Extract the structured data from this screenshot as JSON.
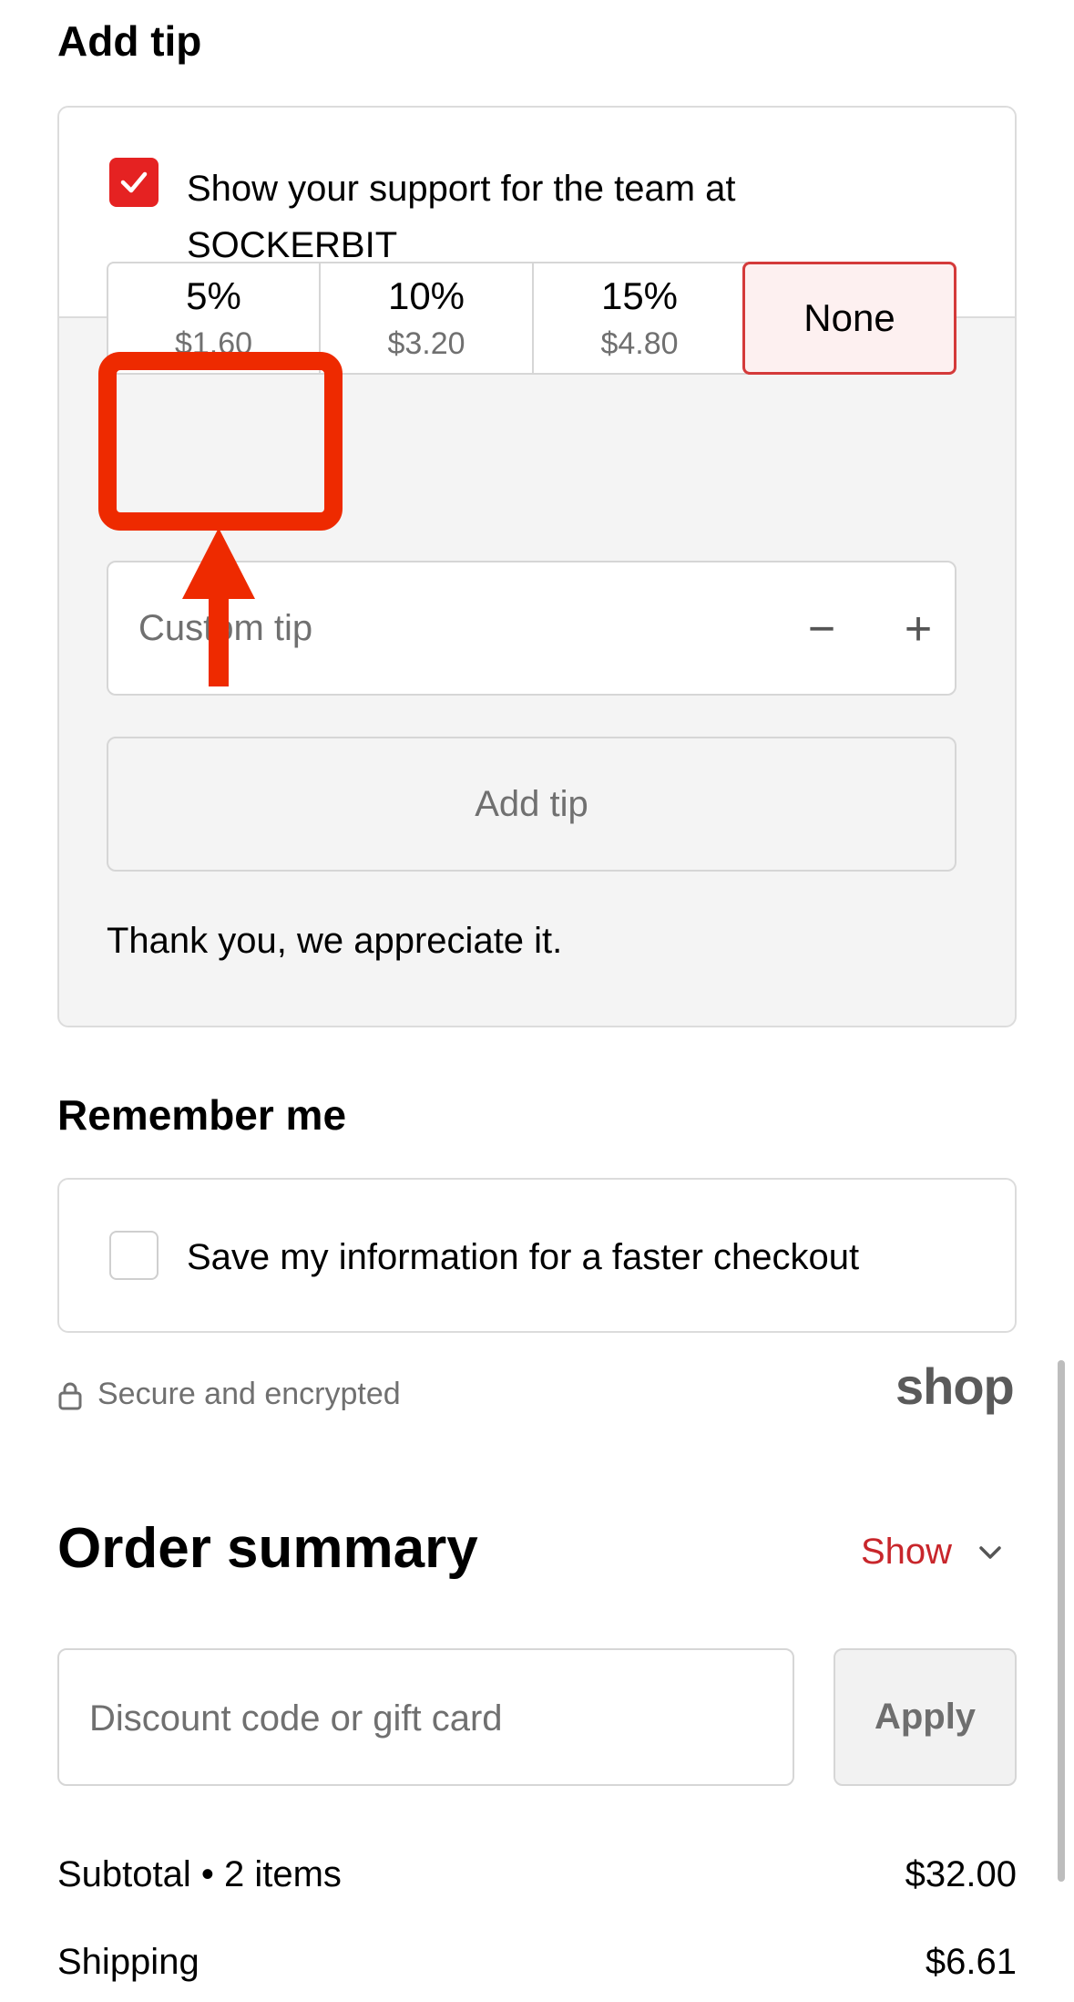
{
  "tip": {
    "heading": "Add tip",
    "support_checkbox": {
      "checked": true,
      "label_line1": "Show your support for the team at",
      "label_line2": "SOCKERBIT"
    },
    "options": [
      {
        "percent": "5%",
        "amount": "$1.60",
        "selected": false
      },
      {
        "percent": "10%",
        "amount": "$3.20",
        "selected": false
      },
      {
        "percent": "15%",
        "amount": "$4.80",
        "selected": false
      },
      {
        "percent": "None",
        "amount": "",
        "selected": true
      }
    ],
    "custom_tip_placeholder": "Custom tip",
    "decrement_symbol": "−",
    "increment_symbol": "+",
    "add_button_label": "Add tip",
    "thanks_text": "Thank you, we appreciate it."
  },
  "remember": {
    "heading": "Remember me",
    "checkbox_checked": false,
    "label": "Save my information for a faster checkout"
  },
  "security": {
    "text": "Secure and encrypted",
    "brand": "shop"
  },
  "order_summary": {
    "title": "Order summary",
    "toggle_label": "Show",
    "discount_placeholder": "Discount code or gift card",
    "apply_label": "Apply",
    "lines": [
      {
        "label": "Subtotal • 2 items",
        "value": "$32.00"
      },
      {
        "label": "Shipping",
        "value": "$6.61"
      }
    ]
  },
  "colors": {
    "accent_red": "#e52222",
    "annotation_red": "#ee2a00",
    "selected_bg": "#fdf0f0"
  }
}
